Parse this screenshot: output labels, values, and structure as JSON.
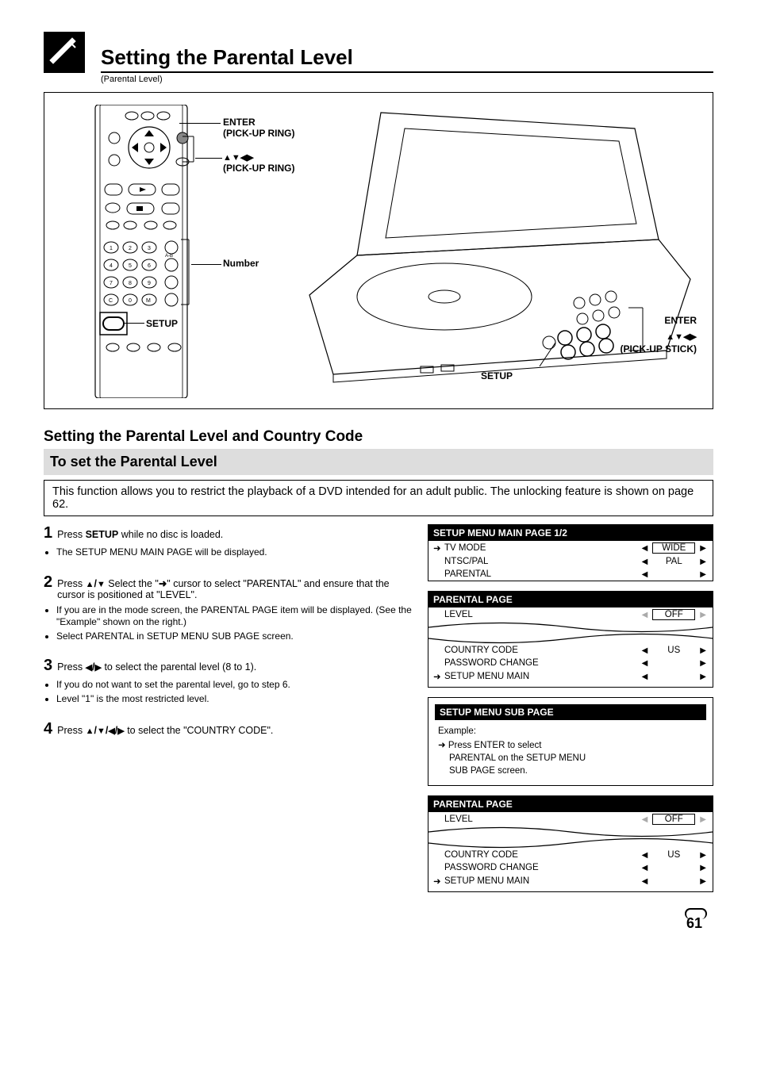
{
  "header": {
    "title": "Setting the Parental Level",
    "subtitle": "(Parental Level)"
  },
  "section": {
    "heading": "Setting the Parental Level and Country Code",
    "barTitle": "To set the Parental Level",
    "description": "This function allows you to restrict the playback of a DVD intended for an adult public. The unlocking feature is shown on page 62."
  },
  "labels": {
    "pickup_ring": "PICK-UP RING",
    "pickup_stick": "PICK-UP STICK",
    "enter_long": "ENTER (PICK-UP RING)",
    "enter_short": "ENTER",
    "number": "Number",
    "setup": "SETUP",
    "arrows_remote_suffix": "(PICK-UP RING)",
    "arrows_player_suffix": "(PICK-UP STICK)"
  },
  "steps": [
    {
      "num": "1",
      "title_pre": "Press ",
      "title_bold": "SETUP",
      "title_post": " while no disc is loaded.",
      "bullets": [
        "The SETUP MENU MAIN PAGE will be displayed."
      ]
    },
    {
      "num": "2",
      "title_pre": "Press ",
      "title_bold_mid": " Select the \"",
      "title_cursor": "\" cursor to select \"PARENTAL\" and ensure that the cursor is positioned at \"LEVEL\".",
      "bullets": [
        "If you are in the mode screen, the PARENTAL PAGE item will be displayed. (See the \"Example\" shown on the right.)",
        "Select PARENTAL in SETUP MENU SUB PAGE screen."
      ]
    },
    {
      "num": "3",
      "title_pre": "Press ",
      "title_post": " to select the parental level (8 to 1).",
      "bullets": [
        "If you do not want to set the parental level, go to step 6.",
        "Level \"1\" is the most restricted level."
      ]
    },
    {
      "num": "4",
      "title_pre": "Press ",
      "title_post": " to select the \"COUNTRY CODE\".",
      "bullets": []
    }
  ],
  "menus": {
    "main": {
      "title": "SETUP MENU MAIN PAGE 1/2",
      "rows": [
        {
          "cursor": true,
          "name": "TV MODE",
          "left": "◀",
          "val": "WIDE",
          "boxed": true,
          "right": "▶"
        },
        {
          "cursor": false,
          "name": "NTSC/PAL",
          "left": "◀",
          "val": "PAL",
          "boxed": false,
          "right": "▶"
        },
        {
          "cursor": false,
          "name": "PARENTAL",
          "left": "◀",
          "val": "",
          "boxed": false,
          "right": "▶"
        }
      ]
    },
    "parental1": {
      "title": "PARENTAL PAGE",
      "top": {
        "name": "LEVEL",
        "val": "OFF",
        "boxed": true
      },
      "rows": [
        {
          "cursor": false,
          "name": "COUNTRY CODE",
          "left": "◀",
          "val": "US",
          "boxed": false,
          "right": "▶"
        },
        {
          "cursor": false,
          "name": "PASSWORD CHANGE",
          "left": "◀",
          "val": "",
          "boxed": false,
          "right": "▶"
        },
        {
          "cursor": true,
          "name": "SETUP MENU MAIN",
          "left": "◀",
          "val": "",
          "boxed": false,
          "right": "▶"
        }
      ]
    },
    "example": {
      "note_line1": "Example:",
      "note_line2": "Press ENTER to select",
      "note_line3": "PARENTAL on the SETUP MENU",
      "note_line4": "SUB PAGE screen.",
      "title": "SETUP MENU SUB PAGE",
      "row": "PARENTAL"
    },
    "parental2": {
      "title": "PARENTAL PAGE",
      "top": {
        "name": "LEVEL",
        "val": "OFF",
        "boxed": true
      },
      "rows": [
        {
          "cursor": false,
          "name": "COUNTRY CODE",
          "left": "◀",
          "val": "US",
          "boxed": false,
          "right": "▶"
        },
        {
          "cursor": false,
          "name": "PASSWORD CHANGE",
          "left": "◀",
          "val": "",
          "boxed": false,
          "right": "▶"
        },
        {
          "cursor": true,
          "name": "SETUP MENU MAIN",
          "left": "◀",
          "val": "",
          "boxed": false,
          "right": "▶"
        }
      ]
    }
  },
  "page_number": "61"
}
